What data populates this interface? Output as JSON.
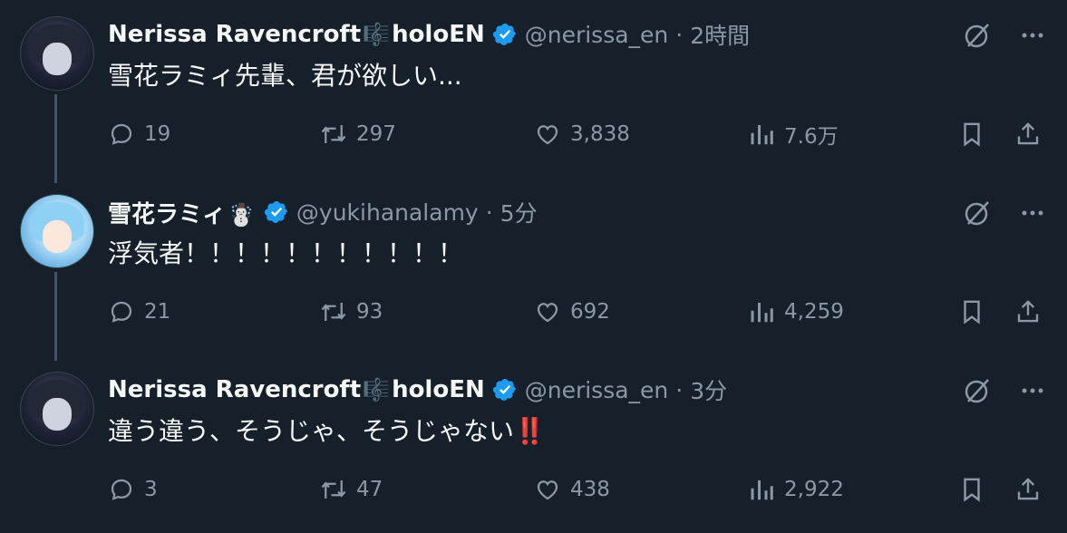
{
  "tweets": [
    {
      "name": "Nerissa Ravencroft",
      "name_emoji": "🎼",
      "name_suffix": "holoEN",
      "handle": "@nerissa_en",
      "time": "2時間",
      "text": "雪花ラミィ先輩、君が欲しい...",
      "text_emphasis": "",
      "replies": "19",
      "retweets": "297",
      "likes": "3,838",
      "views": "7.6万"
    },
    {
      "name": "雪花ラミィ",
      "name_emoji": "☃️",
      "name_suffix": "",
      "handle": "@yukihanalamy",
      "time": "5分",
      "text": "浮気者！！！！！！！！！！！",
      "text_emphasis": "",
      "replies": "21",
      "retweets": "93",
      "likes": "692",
      "views": "4,259"
    },
    {
      "name": "Nerissa Ravencroft",
      "name_emoji": "🎼",
      "name_suffix": "holoEN",
      "handle": "@nerissa_en",
      "time": "3分",
      "text": "違う違う、そうじゃ、そうじゃない",
      "text_emphasis": "‼️",
      "replies": "3",
      "retweets": "47",
      "likes": "438",
      "views": "2,922"
    }
  ],
  "separator": "·",
  "colors": {
    "background": "#15202b",
    "text_primary": "#f7f9f9",
    "text_secondary": "#8b98a5",
    "verified": "#1d9bf0",
    "thread_line": "#425466"
  },
  "icons": [
    "verified-badge-icon",
    "grok-icon",
    "more-icon",
    "reply-icon",
    "retweet-icon",
    "like-icon",
    "views-icon",
    "bookmark-icon",
    "share-icon"
  ]
}
